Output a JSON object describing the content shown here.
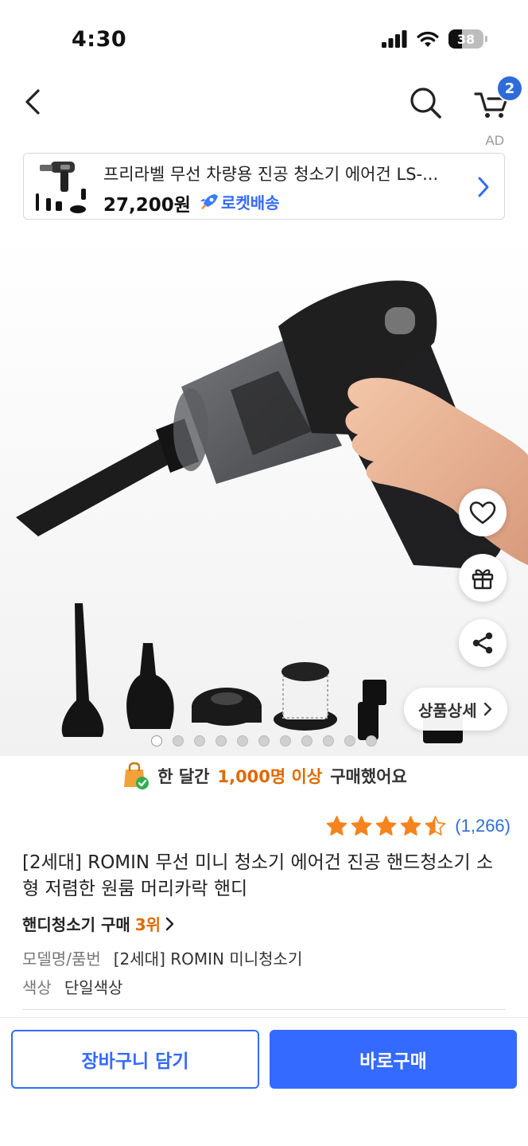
{
  "status_bar": {
    "time": "4:30",
    "battery": "38",
    "battery_level_percent": 38
  },
  "nav": {
    "back_icon": "chevron-left-icon",
    "search_icon": "search-icon",
    "cart_icon": "cart-icon",
    "cart_count": "2"
  },
  "ad": {
    "label": "AD",
    "title": "프리라벨 무선 차량용 진공 청소기 에어건 LS-...",
    "price": "27,200원",
    "rocket_label": "로켓배송"
  },
  "gallery": {
    "detail_button": "상품상세",
    "dot_count": 11,
    "active_dot": 0
  },
  "purchase_note": {
    "prefix": "한 달간",
    "highlight": "1,000명 이상",
    "suffix": "구매했어요"
  },
  "rating": {
    "stars": 4.5,
    "count": "(1,266)"
  },
  "product": {
    "title": "[2세대] ROMIN 무선 미니 청소기 에어건 진공 핸드청소기 소형 저렴한 원룸 머리카락 핸디",
    "ranking_prefix": "핸디청소기 구매",
    "ranking_value": "3위",
    "specs": [
      {
        "key": "모델명/품번",
        "value": "[2세대] ROMIN 미니청소기"
      },
      {
        "key": "색상",
        "value": "단일색상"
      }
    ]
  },
  "buttons": {
    "add_to_cart": "장바구니 담기",
    "buy_now": "바로구매"
  },
  "colors": {
    "accent": "#346aff",
    "badge": "#2e6dd8",
    "highlight": "#e06a00",
    "star": "#f5841f"
  }
}
